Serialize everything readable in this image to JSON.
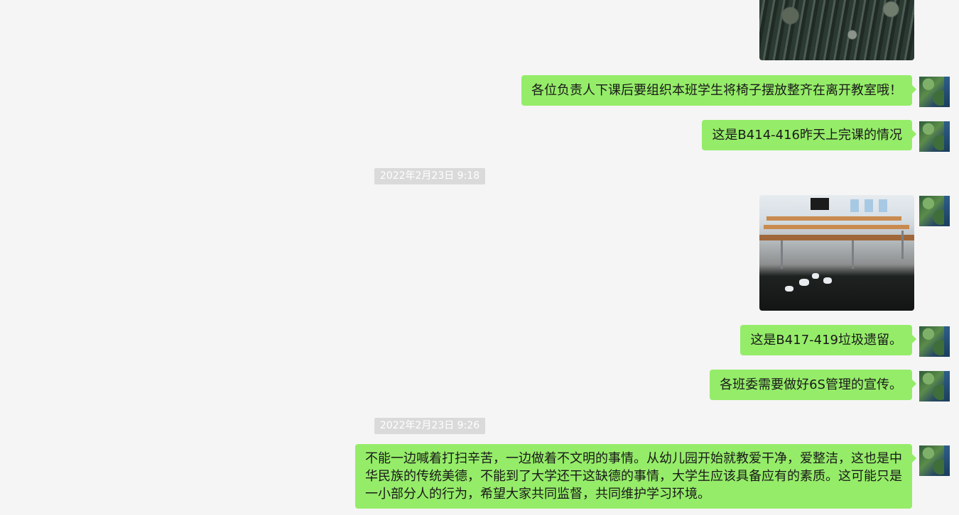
{
  "conversation": {
    "timestamps": [
      "2022年2月23日 9:18",
      "2022年2月23日 9:26"
    ],
    "messages": [
      {
        "type": "image",
        "description": "photo"
      },
      {
        "type": "text",
        "text": "各位负责人下课后要组织本班学生将椅子摆放整齐在离开教室哦！"
      },
      {
        "type": "text",
        "text": "这是B414-416昨天上完课的情况"
      },
      {
        "type": "image",
        "description": "photo"
      },
      {
        "type": "text",
        "text": "这是B417-419垃圾遗留。"
      },
      {
        "type": "text",
        "text": "各班委需要做好6S管理的宣传。"
      },
      {
        "type": "text",
        "text": "不能一边喊着打扫辛苦，一边做着不文明的事情。从幼儿园开始就教爱干净，爱整洁，这也是中华民族的传统美德，不能到了大学还干这缺德的事情，大学生应该具备应有的素质。这可能只是一小部分人的行为，希望大家共同监督，共同维护学习环境。"
      }
    ]
  },
  "colors": {
    "background": "#f5f5f5",
    "outgoing_bubble": "#95ec69",
    "timestamp_bg": "#dadada",
    "timestamp_text": "#ffffff"
  }
}
